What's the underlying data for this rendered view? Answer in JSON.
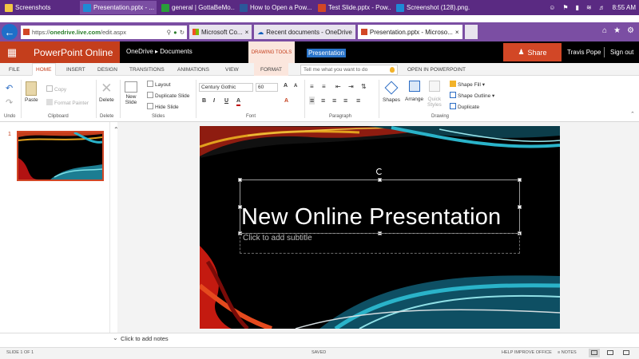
{
  "taskbar": {
    "items": [
      {
        "label": "Screenshots",
        "color": "#f2c744"
      },
      {
        "label": "Presentation.pptx - ...",
        "color": "#1e8ad6"
      },
      {
        "label": "general | GottaBeMo...",
        "color": "#2a9d3a"
      },
      {
        "label": "How to Open a Pow...",
        "color": "#2b579a"
      },
      {
        "label": "Test Slide.pptx - Pow...",
        "color": "#d24726"
      },
      {
        "label": "Screenshot (128).png...",
        "color": "#1e8ad6"
      }
    ],
    "clock": "8:55 AM"
  },
  "browser": {
    "url_prefix": "https://",
    "url_domain": "onedrive.live.com",
    "url_path": "/edit.aspx",
    "tabs": [
      {
        "label": "Microsoft Co...",
        "icon": "microsoft-icon"
      },
      {
        "label": "Recent documents - OneDrive",
        "icon": "cloud-icon"
      },
      {
        "label": "Presentation.pptx - Microso...",
        "icon": "powerpoint-icon"
      }
    ]
  },
  "header": {
    "app_name": "PowerPoint Online",
    "breadcrumb_root": "OneDrive",
    "breadcrumb_folder": "Documents",
    "drawing_tools": "DRAWING TOOLS",
    "doc_title": "Presentation",
    "share_label": "Share",
    "user_name": "Travis Pope",
    "sign_out": "Sign out"
  },
  "ribbon_tabs": {
    "file": "FILE",
    "home": "HOME",
    "insert": "INSERT",
    "design": "DESIGN",
    "transitions": "TRANSITIONS",
    "animations": "ANIMATIONS",
    "view": "VIEW",
    "format": "FORMAT",
    "tell_me": "Tell me what you want to do",
    "open_in_ppt": "OPEN IN POWERPOINT"
  },
  "ribbon": {
    "undo_group": "Undo",
    "clipboard_group": "Clipboard",
    "paste": "Paste",
    "copy": "Copy",
    "format_painter": "Format Painter",
    "delete_label": "Delete",
    "delete_group": "Delete",
    "new_slide_1": "New",
    "new_slide_2": "Slide",
    "layout": "Layout",
    "duplicate_slide": "Duplicate Slide",
    "hide_slide": "Hide Slide",
    "slides_group": "Slides",
    "font_name": "Century Gothic",
    "font_size": "60",
    "bold": "B",
    "italic": "I",
    "underline": "U",
    "font_color": "A",
    "increase": "A",
    "decrease": "A",
    "clear": "A",
    "font_group": "Font",
    "paragraph_group": "Paragraph",
    "shapes": "Shapes",
    "arrange": "Arrange",
    "quick_styles_1": "Quick",
    "quick_styles_2": "Styles",
    "shape_fill": "Shape Fill",
    "shape_outline": "Shape Outline",
    "duplicate": "Duplicate",
    "drawing_group": "Drawing"
  },
  "slides": {
    "thumb_number": "1",
    "title": "New Online Presentation",
    "subtitle_placeholder": "Click to add subtitle"
  },
  "notes": {
    "placeholder": "Click to add notes"
  },
  "status": {
    "slide_info": "SLIDE 1 OF 1",
    "saved": "SAVED",
    "help": "HELP IMPROVE OFFICE",
    "notes_btn": "NOTES"
  }
}
